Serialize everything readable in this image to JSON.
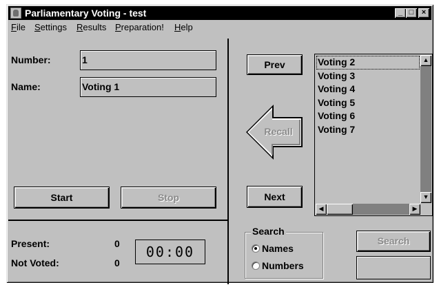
{
  "window": {
    "title": "Parliamentary Voting - test"
  },
  "title_buttons": {
    "minimize": "_",
    "maximize": "□",
    "close": "×"
  },
  "menu": [
    {
      "hot": "F",
      "rest": "ile"
    },
    {
      "hot": "S",
      "rest": "ettings"
    },
    {
      "hot": "R",
      "rest": "esults"
    },
    {
      "hot": "P",
      "rest": "reparation!"
    },
    {
      "hot": "H",
      "rest": "elp"
    }
  ],
  "left": {
    "number_label": "Number:",
    "number_value": "1",
    "name_label": "Name:",
    "name_value": "Voting 1",
    "start_label": "Start",
    "stop_label": "Stop"
  },
  "stats": {
    "present_label": "Present:",
    "present_value": "0",
    "not_voted_label": "Not Voted:",
    "not_voted_value": "0",
    "timer": "00:00"
  },
  "nav": {
    "prev_label": "Prev",
    "recall_label": "Recall",
    "next_label": "Next"
  },
  "voting_list": [
    "Voting 2",
    "Voting 3",
    "Voting 4",
    "Voting 5",
    "Voting 6",
    "Voting 7"
  ],
  "search": {
    "group_title": "Search",
    "options": [
      "Names",
      "Numbers"
    ],
    "selected": "Names",
    "button_label": "Search",
    "query": ""
  }
}
